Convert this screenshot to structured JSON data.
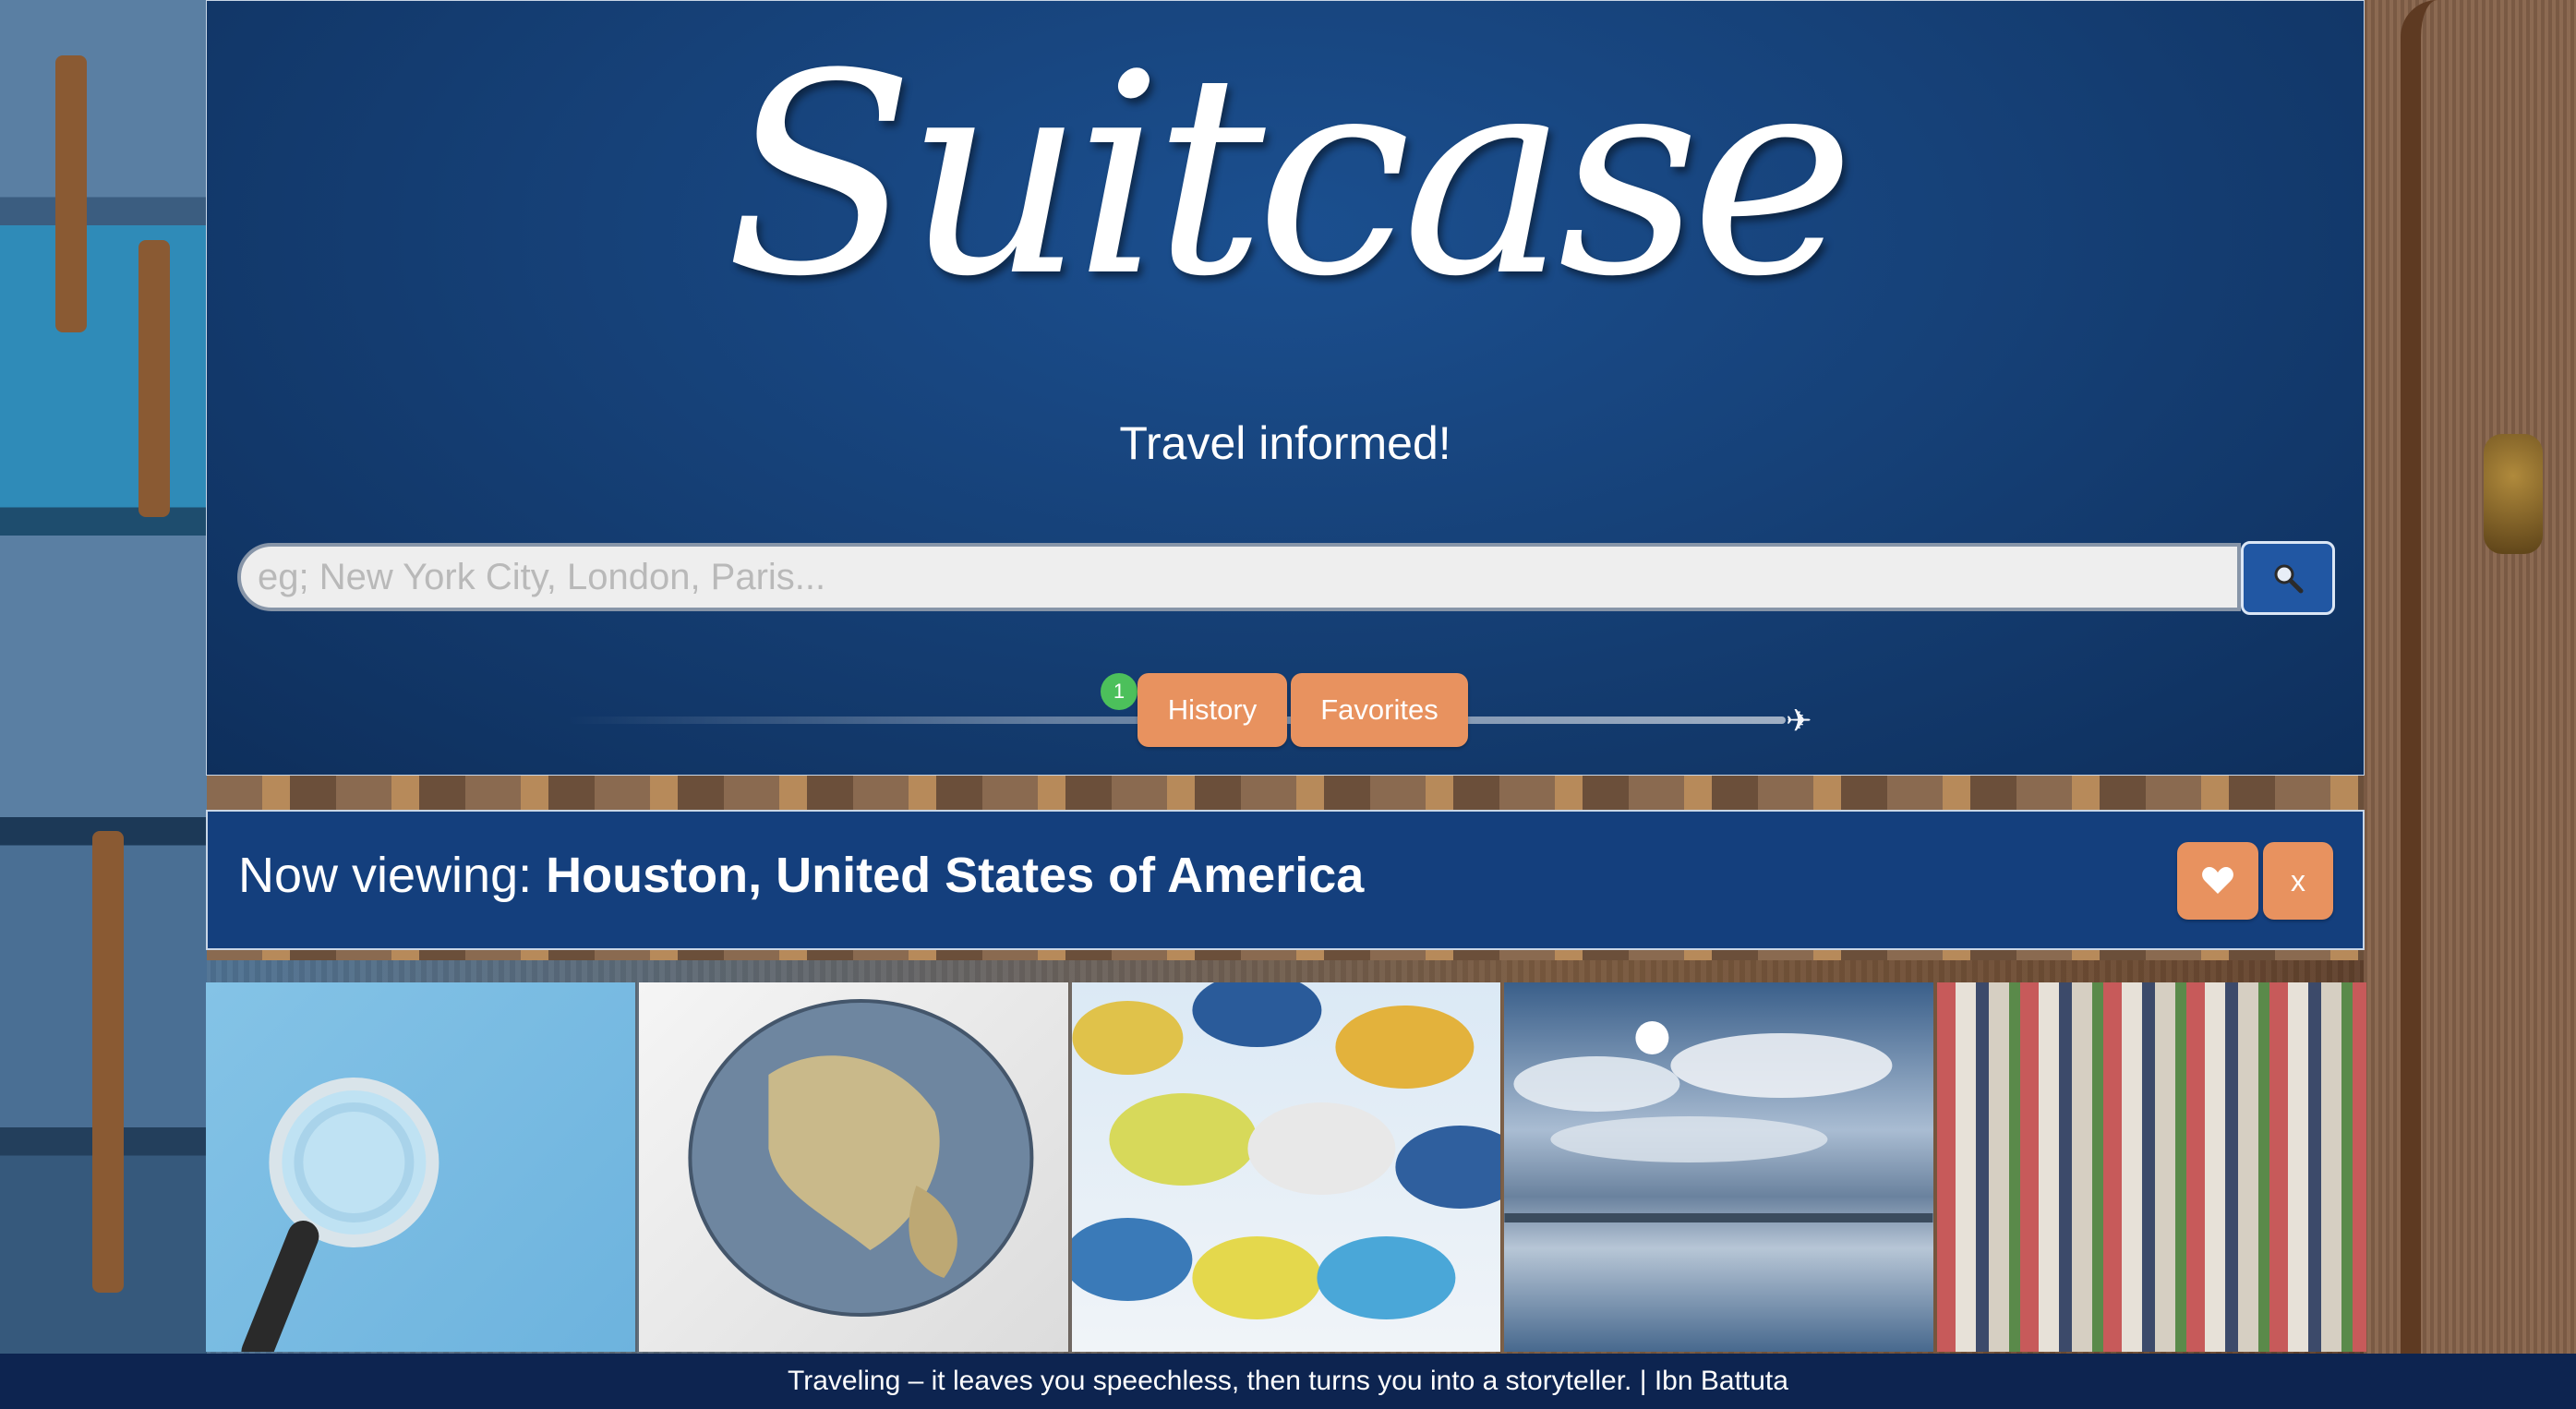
{
  "app": {
    "title": "Suitcase",
    "tagline": "Travel informed!"
  },
  "search": {
    "placeholder": "eg; New York City, London, Paris...",
    "value": "",
    "button_icon": "search-icon"
  },
  "nav": {
    "history_label": "History",
    "favorites_label": "Favorites",
    "history_count": "1"
  },
  "now_viewing": {
    "label": "Now viewing:",
    "city": "Houston, United States of America",
    "favorite_icon": "heart-icon",
    "close_label": "x"
  },
  "gallery": {
    "images": [
      {
        "name": "magnifying-glass-image"
      },
      {
        "name": "globe-image"
      },
      {
        "name": "umbrellas-image"
      },
      {
        "name": "sky-reflection-image"
      },
      {
        "name": "newspapers-image"
      }
    ]
  },
  "footer": {
    "quote": "Traveling – it leaves you speechless, then turns you into a storyteller. | Ibn Battuta"
  },
  "colors": {
    "hero_bg": "#164178",
    "accent_orange": "#e8925f",
    "badge_green": "#4cc05b",
    "search_button": "#2157a3",
    "footer_bg": "#0d2450"
  }
}
